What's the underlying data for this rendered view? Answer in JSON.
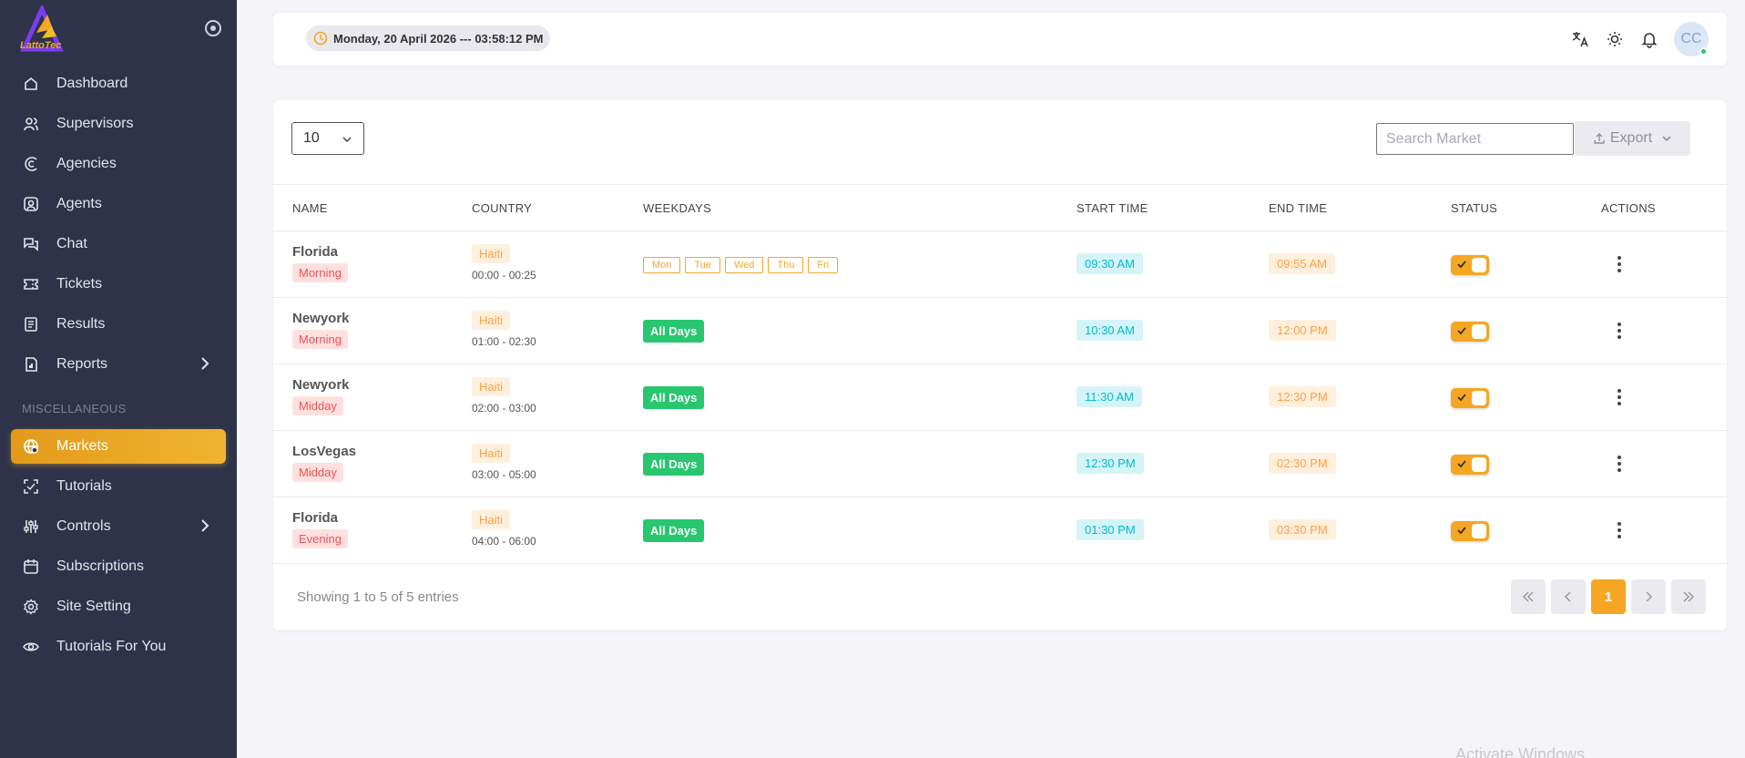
{
  "brand": {
    "logo_text": "LattoTec"
  },
  "sidebar": {
    "items": [
      {
        "label": "Dashboard",
        "icon": "home-icon"
      },
      {
        "label": "Supervisors",
        "icon": "users-icon"
      },
      {
        "label": "Agencies",
        "icon": "agency-icon"
      },
      {
        "label": "Agents",
        "icon": "agent-icon"
      },
      {
        "label": "Chat",
        "icon": "chat-icon"
      },
      {
        "label": "Tickets",
        "icon": "ticket-icon"
      },
      {
        "label": "Results",
        "icon": "results-icon"
      },
      {
        "label": "Reports",
        "icon": "reports-icon"
      }
    ],
    "section_label": "MISCELLANEOUS",
    "misc_items": [
      {
        "label": "Markets",
        "icon": "globe-icon",
        "active": true
      },
      {
        "label": "Tutorials",
        "icon": "scan-icon"
      },
      {
        "label": "Controls",
        "icon": "sliders-icon"
      },
      {
        "label": "Subscriptions",
        "icon": "calendar-icon"
      },
      {
        "label": "Site Setting",
        "icon": "gear-icon"
      },
      {
        "label": "Tutorials For You",
        "icon": "eye-icon"
      }
    ]
  },
  "header": {
    "datetime": "Monday, 20 April 2026 --- 03:58:12 PM",
    "avatar_initials": "CC"
  },
  "table": {
    "page_size": "10",
    "search_placeholder": "Search Market",
    "export_label": "Export",
    "columns": [
      "NAME",
      "COUNTRY",
      "WEEKDAYS",
      "START TIME",
      "END TIME",
      "STATUS",
      "ACTIONS"
    ],
    "rows": [
      {
        "name": "Florida",
        "slot": "Morning",
        "country": "Haiti",
        "hours": "00:00 - 00:25",
        "weekdays": [
          "Mon",
          "Tue",
          "Wed",
          "Thu",
          "Fri"
        ],
        "start": "09:30 AM",
        "end": "09:55 AM",
        "status": true
      },
      {
        "name": "Newyork",
        "slot": "Morning",
        "country": "Haiti",
        "hours": "01:00 - 02:30",
        "weekdays": "All Days",
        "start": "10:30 AM",
        "end": "12:00 PM",
        "status": true
      },
      {
        "name": "Newyork",
        "slot": "Midday",
        "country": "Haiti",
        "hours": "02:00 - 03:00",
        "weekdays": "All Days",
        "start": "11:30 AM",
        "end": "12:30 PM",
        "status": true
      },
      {
        "name": "LosVegas",
        "slot": "Midday",
        "country": "Haiti",
        "hours": "03:00 - 05:00",
        "weekdays": "All Days",
        "start": "12:30 PM",
        "end": "02:30 PM",
        "status": true
      },
      {
        "name": "Florida",
        "slot": "Evening",
        "country": "Haiti",
        "hours": "04:00 - 06:00",
        "weekdays": "All Days",
        "start": "01:30 PM",
        "end": "03:30 PM",
        "status": true
      }
    ],
    "footer_info": "Showing 1 to 5 of 5 entries",
    "current_page": "1"
  },
  "watermark": "Activate Windows",
  "colors": {
    "sidebar_bg": "#2f3349",
    "accent": "#f5a623",
    "success": "#28c76f",
    "danger": "#ea5455"
  }
}
